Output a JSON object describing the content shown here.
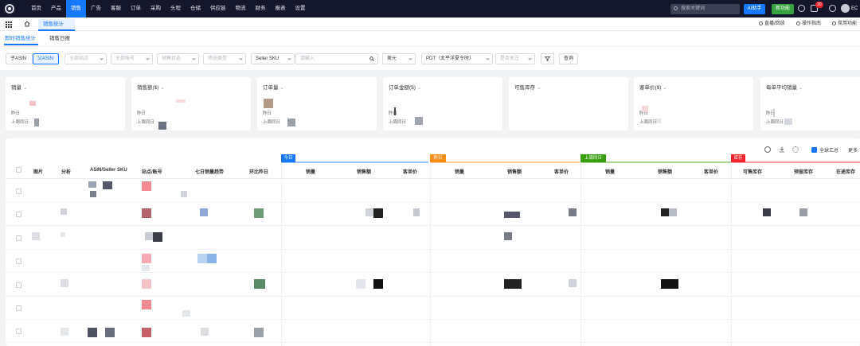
{
  "nav": [
    "首页",
    "产品",
    "销售",
    "广告",
    "客服",
    "订单",
    "采购",
    "头程",
    "仓储",
    "供应链",
    "物流",
    "财务",
    "报表",
    "设置"
  ],
  "nav_active_index": 2,
  "topbar": {
    "search_placeholder": "搜索关键词",
    "ai_label": "AI助手",
    "new_label": "新功能",
    "badge": "20",
    "user": "EC"
  },
  "tab": {
    "label": "销售统计"
  },
  "right_tools": [
    "直播/回放",
    "操作指南",
    "常用功能"
  ],
  "subtabs": [
    "即时销售统计",
    "销售日报"
  ],
  "filters": {
    "parent_asin": "子ASIN",
    "asin": "父ASIN",
    "site": "全部站点",
    "store": "全部账号",
    "status": "销售状态",
    "type": "筛选类型",
    "sku_type": "Seller SKU",
    "search_placeholder": "请输入",
    "currency": "美元",
    "timezone": "PDT（太平洋夏令时）",
    "follow": "是否关注",
    "query": "查询"
  },
  "cards": [
    {
      "title": "销量",
      "l1": "昨日",
      "l2": "上周同日"
    },
    {
      "title": "销售额($)",
      "l1": "昨日",
      "l2": "上周同日"
    },
    {
      "title": "订单量",
      "l1": "昨日",
      "l2": "上周同日"
    },
    {
      "title": "订单金额($)",
      "l1": "昨日",
      "l2": "上周同日"
    },
    {
      "title": "可售库存",
      "l1": "",
      "l2": ""
    },
    {
      "title": "客单价($)",
      "l1": "昨日",
      "l2": "上周同日"
    },
    {
      "title": "每单平均销量",
      "l1": "昨日",
      "l2": "上周同日"
    }
  ],
  "table": {
    "summary_label": "全球汇总",
    "more_label": "更多",
    "groups": [
      {
        "label": "今日",
        "color": "#1677ff"
      },
      {
        "label": "昨日",
        "color": "#fa8c16"
      },
      {
        "label": "上周同日",
        "color": "#389e0d"
      },
      {
        "label": "库存",
        "color": "#f5222d"
      }
    ],
    "headers": [
      "图片",
      "分析",
      "ASIN/Seller SKU",
      "站点/账号",
      "七日销量趋势",
      "环比昨日",
      "销量",
      "销售额",
      "客单价",
      "销量",
      "销售额",
      "客单价",
      "销量",
      "销售额",
      "客单价",
      "可售库存",
      "预留库存",
      "在途库存"
    ]
  }
}
